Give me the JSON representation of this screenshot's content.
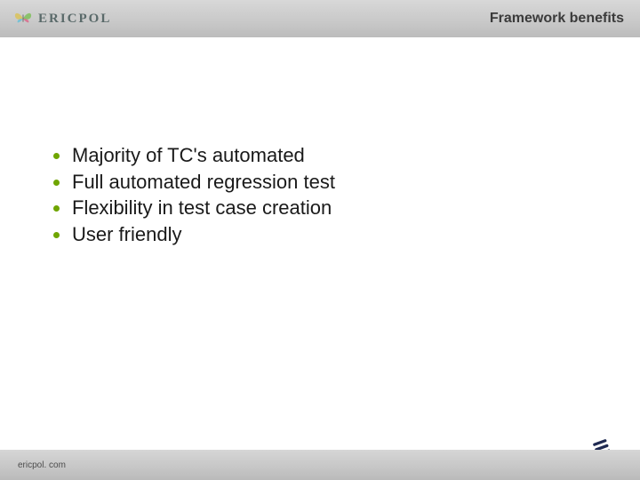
{
  "header": {
    "logo_text": "ERICPOL",
    "title": "Framework benefits"
  },
  "bullets": [
    "Majority of TC's automated",
    "Full automated regression test",
    "Flexibility in test case creation",
    "User friendly"
  ],
  "footer": {
    "url": "ericpol. com",
    "partner_logo_label": "ERICSSON"
  },
  "colors": {
    "bullet": "#6fa500",
    "header_text": "#3b3b3b"
  }
}
